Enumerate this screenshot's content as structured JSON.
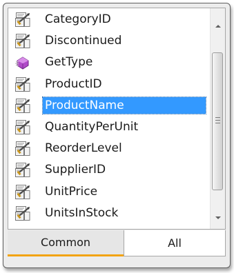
{
  "list": {
    "items": [
      {
        "label": "CategoryID",
        "icon": "property-icon",
        "selected": false
      },
      {
        "label": "Discontinued",
        "icon": "property-icon",
        "selected": false
      },
      {
        "label": "GetType",
        "icon": "method-icon",
        "selected": false
      },
      {
        "label": "ProductID",
        "icon": "property-icon",
        "selected": false
      },
      {
        "label": "ProductName",
        "icon": "property-icon",
        "selected": true
      },
      {
        "label": "QuantityPerUnit",
        "icon": "property-icon",
        "selected": false
      },
      {
        "label": "ReorderLevel",
        "icon": "property-icon",
        "selected": false
      },
      {
        "label": "SupplierID",
        "icon": "property-icon",
        "selected": false
      },
      {
        "label": "UnitPrice",
        "icon": "property-icon",
        "selected": false
      },
      {
        "label": "UnitsInStock",
        "icon": "property-icon",
        "selected": false
      }
    ]
  },
  "tabs": [
    {
      "label": "Common",
      "active": true
    },
    {
      "label": "All",
      "active": false
    }
  ],
  "colors": {
    "selection": "#3399ff",
    "active_tab_indicator": "#f2a30f",
    "method_icon": "#b04ac8"
  }
}
